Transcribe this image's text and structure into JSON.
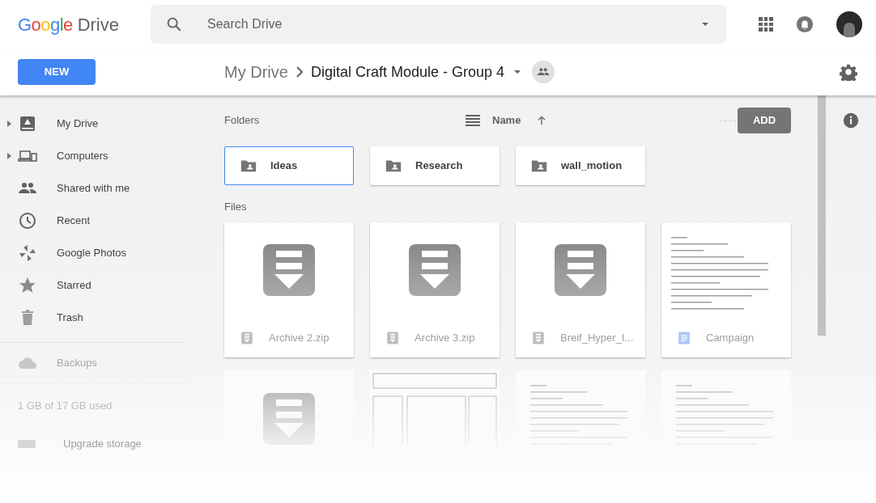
{
  "app": {
    "logo_word_1": "Google",
    "logo_word_2": "Drive"
  },
  "search": {
    "placeholder": "Search Drive"
  },
  "new_button": "NEW",
  "breadcrumb": [
    {
      "label": "My Drive",
      "current": false
    },
    {
      "label": "Digital Craft Module - Group 4",
      "current": true
    }
  ],
  "sidebar": {
    "items": [
      {
        "label": "My Drive",
        "kind": "drive",
        "expander": true
      },
      {
        "label": "Computers",
        "kind": "computers",
        "expander": true
      },
      {
        "label": "Shared with me",
        "kind": "shared",
        "expander": false
      },
      {
        "label": "Recent",
        "kind": "clock",
        "expander": false
      },
      {
        "label": "Google Photos",
        "kind": "pinwheel",
        "expander": false
      },
      {
        "label": "Starred",
        "kind": "star",
        "expander": false
      },
      {
        "label": "Trash",
        "kind": "trash",
        "expander": false
      }
    ],
    "backups": "Backups",
    "storage": "1 GB of 17 GB used",
    "upgrade": "Upgrade storage"
  },
  "folders_heading": "Folders",
  "sort": {
    "label": "Name",
    "ascending": true
  },
  "add_button": "ADD",
  "folders": [
    {
      "name": "Ideas",
      "selected": true
    },
    {
      "name": "Research",
      "selected": false
    },
    {
      "name": "wall_motion",
      "selected": false
    }
  ],
  "files_heading": "Files",
  "files": [
    {
      "name": "Archive 2.zip",
      "kind": "archive"
    },
    {
      "name": "Archive 3.zip",
      "kind": "archive"
    },
    {
      "name": "Breif_Hyper_I...",
      "kind": "archive"
    },
    {
      "name": "Campaign",
      "kind": "doc"
    }
  ],
  "more_files": [
    {
      "kind": "archive"
    },
    {
      "kind": "slides"
    },
    {
      "kind": "doc"
    },
    {
      "kind": "doc"
    }
  ]
}
